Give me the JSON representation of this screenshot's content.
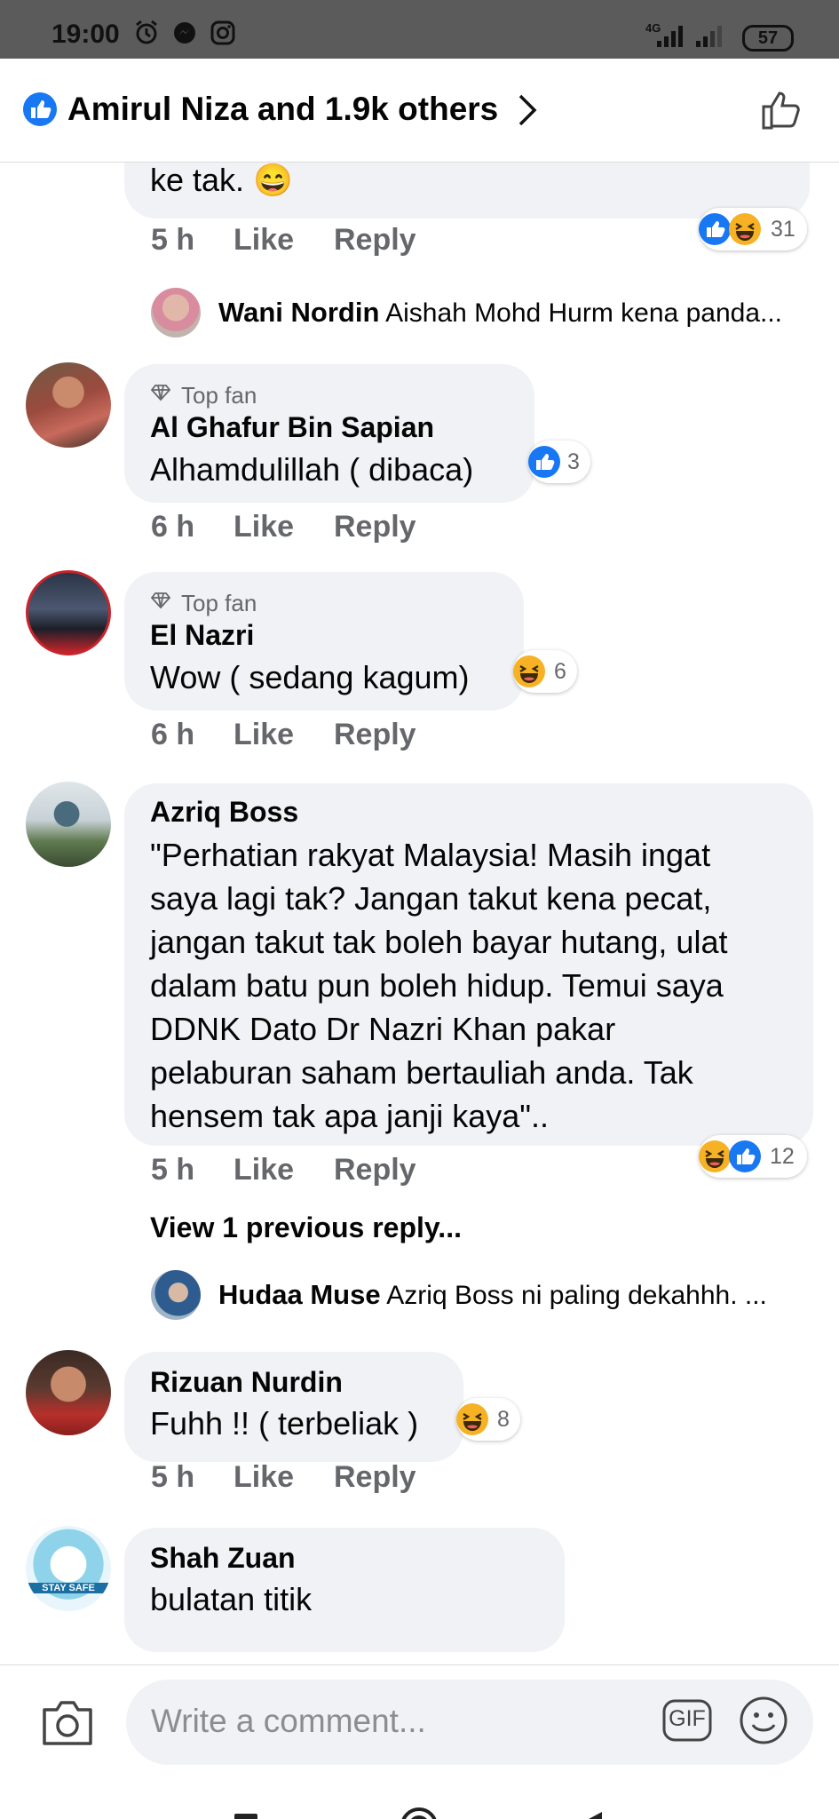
{
  "status": {
    "time": "19:00",
    "network": "4G",
    "battery": "57"
  },
  "header": {
    "title": "Amirul Niza and 1.9k others"
  },
  "comments": [
    {
      "text": "ke tak. 😄",
      "time": "5 h",
      "like": "Like",
      "reply": "Reply",
      "reactions": "31"
    },
    {
      "reply_preview": {
        "name": "Wani Nordin",
        "text": "Aishah Mohd Hurm kena panda..."
      }
    },
    {
      "badge": "Top fan",
      "name": "Al Ghafur Bin Sapian",
      "text": "Alhamdulillah ( dibaca)",
      "time": "6 h",
      "like": "Like",
      "reply": "Reply",
      "reactions": "3"
    },
    {
      "badge": "Top fan",
      "name": "El Nazri",
      "text": "Wow ( sedang kagum)",
      "time": "6 h",
      "like": "Like",
      "reply": "Reply",
      "reactions": "6"
    },
    {
      "name": "Azriq Boss",
      "lines": [
        "\"Perhatian rakyat Malaysia! Masih ingat",
        "saya lagi tak? Jangan takut kena pecat,",
        "jangan takut tak boleh bayar hutang, ulat",
        "dalam batu pun boleh hidup. Temui saya",
        "DDNK Dato Dr Nazri Khan pakar",
        "pelaburan saham bertauliah anda. Tak",
        "hensem tak apa janji kaya\".."
      ],
      "time": "5 h",
      "like": "Like",
      "reply": "Reply",
      "reactions": "12",
      "view_previous": "View 1 previous reply...",
      "reply_preview": {
        "name": "Hudaa Muse",
        "text": "Azriq Boss ni paling dekahhh. ..."
      }
    },
    {
      "name": "Rizuan Nurdin",
      "text": "Fuhh !! ( terbeliak )",
      "time": "5 h",
      "like": "Like",
      "reply": "Reply",
      "reactions": "8"
    },
    {
      "name": "Shah Zuan",
      "text": "bulatan titik",
      "avatar_caption": "STAY SAFE"
    }
  ],
  "composer": {
    "placeholder": "Write a comment...",
    "gif": "GIF"
  },
  "colors": {
    "facebook_blue": "#1877f2",
    "bubble_gray": "#f0f2f5",
    "meta_gray": "#65676b",
    "status_bar": "#5b5b5b"
  }
}
